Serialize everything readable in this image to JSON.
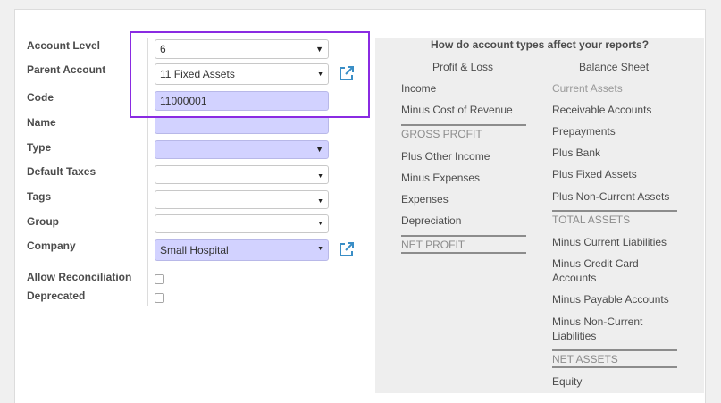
{
  "form": {
    "labels": {
      "account_level": "Account Level",
      "parent_account": "Parent Account",
      "code": "Code",
      "name": "Name",
      "type": "Type",
      "default_taxes": "Default Taxes",
      "tags": "Tags",
      "group": "Group",
      "company": "Company",
      "allow_reconciliation": "Allow Reconciliation",
      "deprecated": "Deprecated"
    },
    "values": {
      "account_level": "6",
      "parent_account": "11 Fixed Assets",
      "code": "11000001",
      "name": "",
      "type": "",
      "default_taxes": "",
      "tags": "",
      "group": "",
      "company": "Small Hospital"
    },
    "checkboxes": {
      "allow_reconciliation": false,
      "deprecated": false
    },
    "icons": {
      "external_link": "external-link-icon",
      "dropdown": "caret-down-icon"
    },
    "highlight_color": "#8a2be2",
    "required_bg": "#d2d2ff"
  },
  "help_panel": {
    "title": "How do account types affect your reports?",
    "profit_loss": {
      "heading": "Profit & Loss",
      "items": [
        "Income",
        "Minus Cost of Revenue",
        "GROSS PROFIT",
        "Plus Other Income",
        "Minus Expenses",
        "Expenses",
        "Depreciation",
        "NET PROFIT"
      ]
    },
    "balance_sheet": {
      "heading": "Balance Sheet",
      "items": [
        "Current Assets",
        "Receivable Accounts",
        "Prepayments",
        "Plus Bank",
        "Plus Fixed Assets",
        "Plus Non-Current Assets",
        "TOTAL ASSETS",
        "Minus Current Liabilities",
        "Minus Credit Card Accounts",
        "Minus Payable Accounts",
        "Minus Non-Current Liabilities",
        "NET ASSETS",
        "Equity"
      ]
    }
  }
}
